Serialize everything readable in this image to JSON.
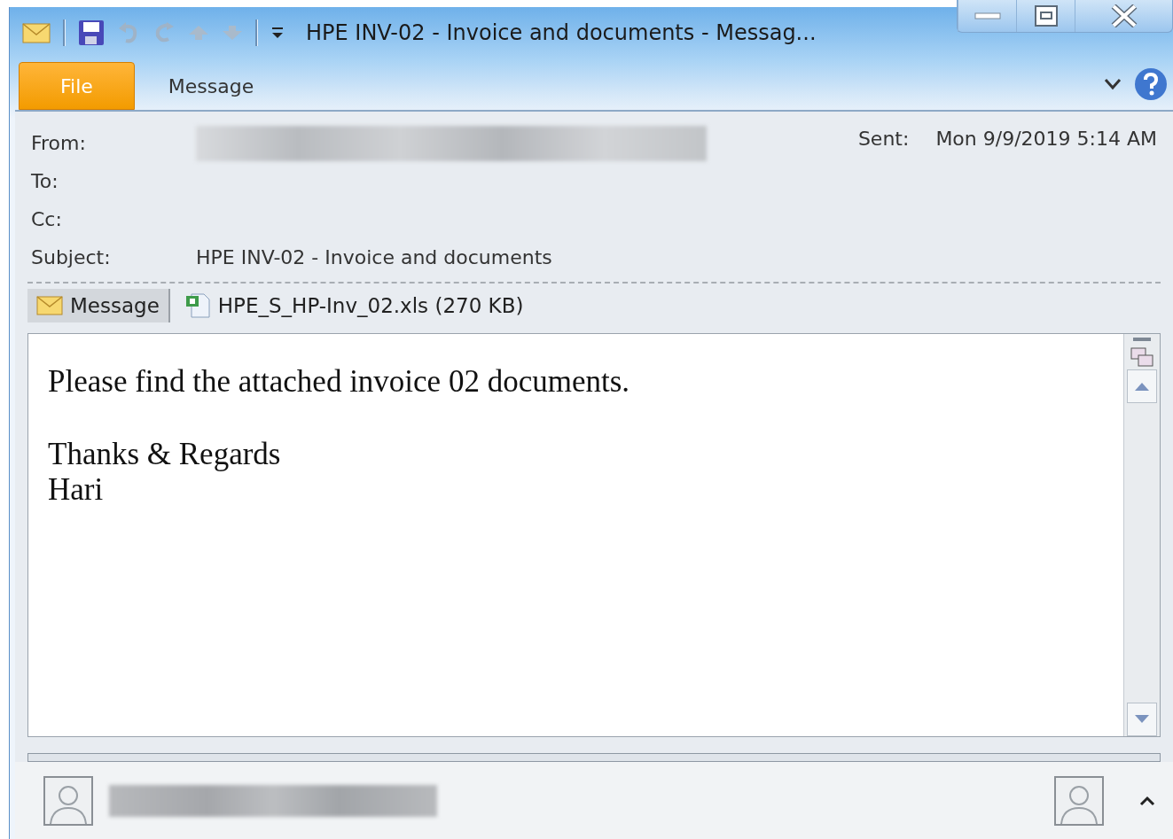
{
  "window": {
    "title": "HPE INV-02 - Invoice and documents  -  Messag..."
  },
  "ribbon_tabs": [
    {
      "kind": "file",
      "label": "File"
    },
    {
      "kind": "tab",
      "label": "Message"
    }
  ],
  "header": {
    "fields": [
      {
        "label": "From:",
        "blurred": true
      },
      {
        "label": "To:"
      },
      {
        "label": "Cc:"
      },
      {
        "label": "Subject:",
        "value": "HPE INV-02 - Invoice and documents"
      }
    ],
    "sent": {
      "label": "Sent:",
      "value": "Mon 9/9/2019 5:14 AM"
    }
  },
  "attachments": [
    {
      "kind": "message",
      "label": "Message",
      "selected": true
    },
    {
      "kind": "file",
      "label": "HPE_S_HP-Inv_02.xls (270 KB)",
      "selected": false
    }
  ],
  "body": {
    "paragraphs": [
      [
        "Please find the attached invoice 02 documents."
      ],
      [
        "Thanks & Regards",
        "Hari"
      ]
    ]
  }
}
